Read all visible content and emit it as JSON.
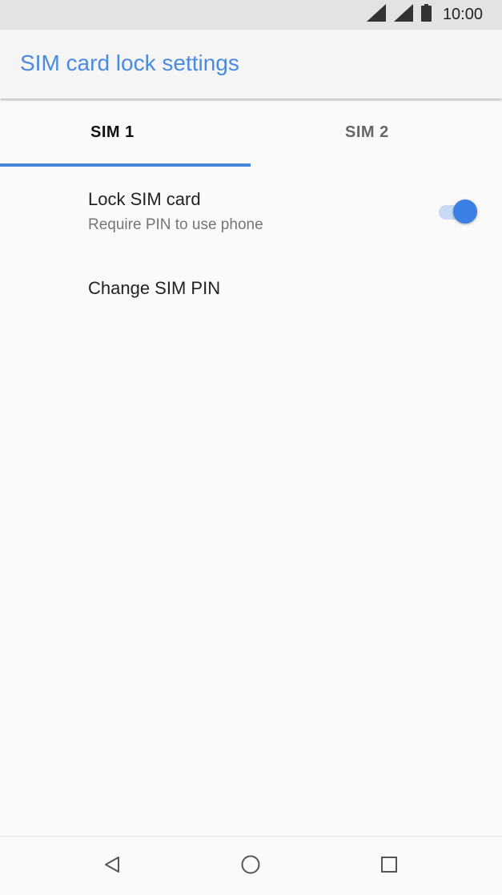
{
  "status_bar": {
    "time": "10:00",
    "icons": [
      "signal-icon",
      "signal-icon",
      "battery-icon"
    ]
  },
  "app_bar": {
    "title": "SIM card lock settings"
  },
  "tabs": [
    {
      "label": "SIM 1",
      "selected": true
    },
    {
      "label": "SIM 2",
      "selected": false
    }
  ],
  "preferences": [
    {
      "title": "Lock SIM card",
      "summary": "Require PIN to use phone",
      "toggle_on": true
    },
    {
      "title": "Change SIM PIN"
    }
  ],
  "nav_bar": {
    "buttons": [
      "back-icon",
      "home-icon",
      "recents-icon"
    ]
  },
  "colors": {
    "accent": "#4a8ae0",
    "toggle_thumb": "#3b7fe2",
    "toggle_track": "#c9daf6"
  }
}
